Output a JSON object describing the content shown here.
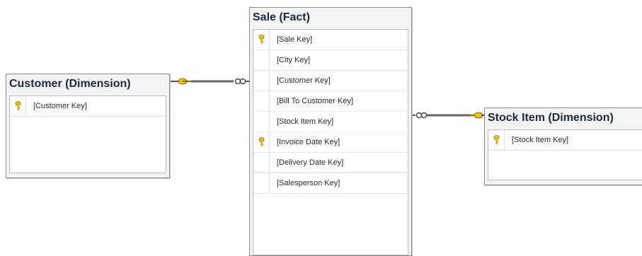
{
  "tables": {
    "customer": {
      "title": "Customer (Dimension)",
      "columns": [
        {
          "name": "[Customer Key]",
          "primary_key": true
        }
      ]
    },
    "sale": {
      "title": "Sale (Fact)",
      "columns": [
        {
          "name": "[Sale Key]",
          "primary_key": true
        },
        {
          "name": "[City Key]",
          "primary_key": false
        },
        {
          "name": "[Customer Key]",
          "primary_key": false
        },
        {
          "name": "[Bill To Customer Key]",
          "primary_key": false
        },
        {
          "name": "[Stock Item Key]",
          "primary_key": false
        },
        {
          "name": "[Invoice Date Key]",
          "primary_key": true
        },
        {
          "name": "[Delivery Date Key]",
          "primary_key": false
        },
        {
          "name": "[Salesperson Key]",
          "primary_key": false
        }
      ]
    },
    "stock_item": {
      "title": "Stock Item (Dimension)",
      "columns": [
        {
          "name": "[Stock Item Key]",
          "primary_key": true
        }
      ]
    }
  },
  "relationships": [
    {
      "from": "customer",
      "to": "sale",
      "one_end": "customer",
      "many_end": "sale"
    },
    {
      "from": "sale",
      "to": "stock_item",
      "one_end": "stock_item",
      "many_end": "sale"
    }
  ],
  "colors": {
    "key_icon": "#e8c21a",
    "line": "#555555",
    "title": "#1e2a3a"
  }
}
